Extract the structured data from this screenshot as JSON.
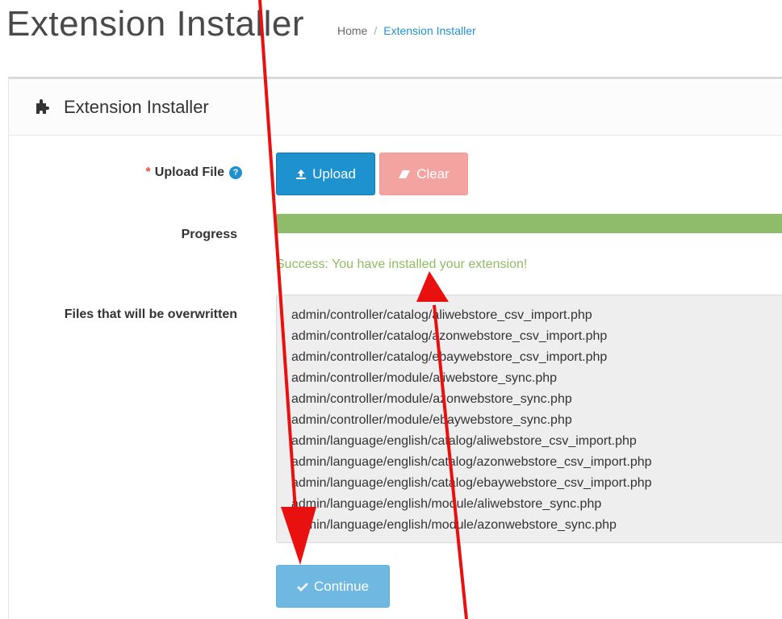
{
  "header": {
    "title": "Extension Installer",
    "breadcrumb": {
      "home": "Home",
      "separator": "/",
      "current": "Extension Installer"
    }
  },
  "panel": {
    "heading": "Extension Installer",
    "heading_icon": "puzzle-icon"
  },
  "form": {
    "required_star": "*",
    "upload_label": "Upload File",
    "help_glyph": "?",
    "upload_button": "Upload",
    "clear_button": "Clear",
    "progress_label": "Progress",
    "progress_percent": 100,
    "success_message": "Success: You have installed your extension!",
    "files_label": "Files that will be overwritten",
    "files": [
      "admin/controller/catalog/aliwebstore_csv_import.php",
      "admin/controller/catalog/azonwebstore_csv_import.php",
      "admin/controller/catalog/ebaywebstore_csv_import.php",
      "admin/controller/module/aliwebstore_sync.php",
      "admin/controller/module/azonwebstore_sync.php",
      "admin/controller/module/ebaywebstore_sync.php",
      "admin/language/english/catalog/aliwebstore_csv_import.php",
      "admin/language/english/catalog/azonwebstore_csv_import.php",
      "admin/language/english/catalog/ebaywebstore_csv_import.php",
      "admin/language/english/module/aliwebstore_sync.php",
      "admin/language/english/module/azonwebstore_sync.php"
    ],
    "continue_button": "Continue"
  },
  "colors": {
    "primary": "#1e91cf",
    "danger_light": "#f3a3a0",
    "success": "#8fbc6b",
    "annotation_arrow": "#e8110f"
  }
}
